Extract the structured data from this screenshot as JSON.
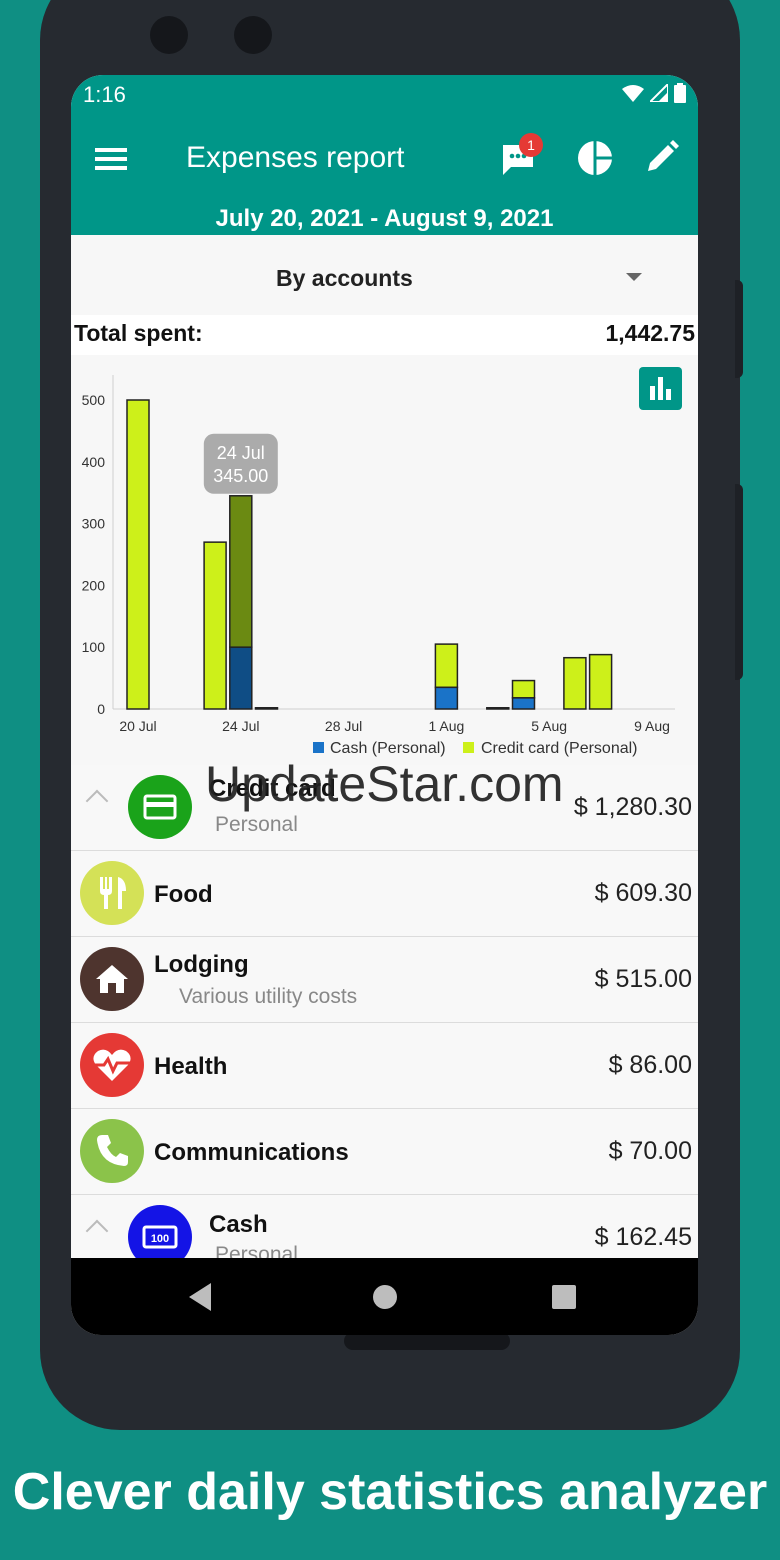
{
  "status_bar": {
    "time": "1:16"
  },
  "app_bar": {
    "title": "Expenses report",
    "date_range": "July 20, 2021 - August 9, 2021",
    "badge_count": "1"
  },
  "selector": {
    "label": "By accounts"
  },
  "summary": {
    "total_label": "Total spent:",
    "total_value": "1,442.75"
  },
  "chart_data": {
    "type": "bar",
    "stacked": true,
    "y_ticks": [
      0,
      100,
      200,
      300,
      400,
      500
    ],
    "ylim": [
      0,
      500
    ],
    "x_tick_labels": [
      "20 Jul",
      "24 Jul",
      "28 Jul",
      "1 Aug",
      "5 Aug",
      "9 Aug"
    ],
    "tooltip": {
      "date": "24 Jul",
      "value": "345.00"
    },
    "series": [
      {
        "name": "Cash (Personal)",
        "color": "#1a73c8"
      },
      {
        "name": "Credit card (Personal)",
        "color": "#cdf01a"
      }
    ],
    "bars": [
      {
        "date": "20 Jul",
        "cash": 0,
        "credit": 500
      },
      {
        "date": "23 Jul",
        "cash": 0,
        "credit": 270
      },
      {
        "date": "24 Jul",
        "cash": 100,
        "credit": 245,
        "highlight": true
      },
      {
        "date": "25 Jul",
        "cash": 0,
        "credit": 2
      },
      {
        "date": "1 Aug",
        "cash": 35,
        "credit": 70
      },
      {
        "date": "3 Aug",
        "cash": 0,
        "credit": 2
      },
      {
        "date": "4 Aug",
        "cash": 18,
        "credit": 28
      },
      {
        "date": "6 Aug",
        "cash": 0,
        "credit": 83
      },
      {
        "date": "7 Aug",
        "cash": 0,
        "credit": 88
      }
    ]
  },
  "list": {
    "credit_card": {
      "name": "Credit card",
      "sub": "Personal",
      "amount": "$ 1,280.30",
      "color": "#1aa31a"
    },
    "food": {
      "name": "Food",
      "amount": "$ 609.30",
      "color": "#d4e157"
    },
    "lodging": {
      "name": "Lodging",
      "sub": "Various utility costs",
      "amount": "$ 515.00",
      "color": "#4e342e"
    },
    "health": {
      "name": "Health",
      "amount": "$ 86.00",
      "color": "#e53935"
    },
    "communications": {
      "name": "Communications",
      "amount": "$ 70.00",
      "color": "#8bc34a"
    },
    "cash": {
      "name": "Cash",
      "sub": "Personal",
      "amount": "$ 162.45",
      "color": "#1414e6"
    }
  },
  "watermark": "UpdateStar.com",
  "caption": "Clever daily statistics analyzer"
}
